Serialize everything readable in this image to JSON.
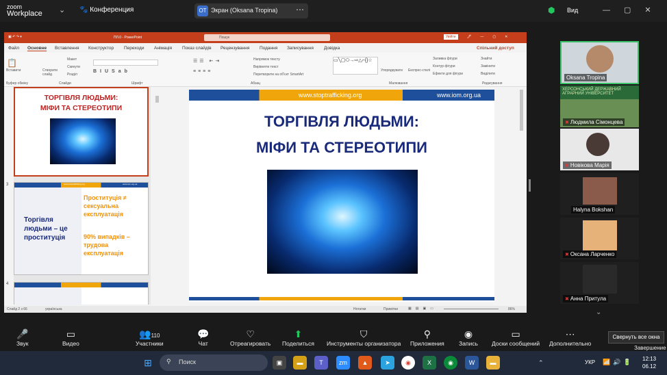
{
  "zoom": {
    "logo_top": "zoom",
    "logo_bottom": "Workplace",
    "conference": "Конференция",
    "screen_badge": "OT",
    "screen_label": "Экран (Oksana Tropina)",
    "view": "Вид"
  },
  "ppt": {
    "title": "ПЛ.0 - PowerPoint",
    "search": "Пошук",
    "account": "Увійти",
    "share": "Спільний доступ",
    "menu": [
      "Файл",
      "Основне",
      "Вставлення",
      "Конструктор",
      "Переходи",
      "Анімація",
      "Показ слайдів",
      "Рецензування",
      "Подання",
      "Записування",
      "Довідка"
    ],
    "ribbon": {
      "paste": "Вставити",
      "new_slide": "Створити слайд",
      "layout": "Макет",
      "reset": "Скинути",
      "section": "Розділ",
      "clipboard": "Буфер обміну",
      "slides": "Слайди",
      "font": "Шрифт",
      "paragraph": "Абзац",
      "drawing": "Малювання",
      "editing": "Редагування",
      "arrange": "Упорядкувати",
      "styles": "Експрес-стилі",
      "find": "Знайти",
      "replace": "Замінити",
      "select": "Виділити",
      "fill": "Заливка фігури",
      "outline": "Контур фігури",
      "effects": "Ефекти для фігури",
      "text_dir": "Напрямок тексту",
      "align_text": "Вирівняти текст",
      "smartart": "Перетворити на об'єкт SmartArt"
    },
    "thumb1": {
      "line1": "ТОРГІВЛЯ ЛЮДЬМИ:",
      "line2": "МІФИ ТА СТЕРЕОТИПИ"
    },
    "thumb2": {
      "num": "3",
      "left": "Торгівля людьми – це проституція",
      "right1": "Проституція ≠ сексуальна експлуатація",
      "right2": "90% випадків – трудова експлуатація",
      "url1": "www.stoptrafficking.org",
      "url2": "www.iom.org.ua"
    },
    "thumb3": {
      "num": "4"
    },
    "main": {
      "url1": "www.stoptrafficking.org",
      "url2": "www.iom.org.ua",
      "line1": "ТОРГІВЛЯ ЛЮДЬМИ:",
      "line2": "МІФИ ТА СТЕРЕОТИПИ"
    },
    "status": {
      "slide": "Слайд 2 з 66",
      "lang": "українська",
      "notes": "Нотатки",
      "comments": "Примітки",
      "zoom": "86%"
    }
  },
  "participants": [
    "Oksana Tropina",
    "Людмила Сімонцева",
    "Новікова Марія",
    "Halyna Bokshan",
    "Оксана Ларченко",
    "Анна Притула"
  ],
  "toolbar": {
    "sound": "Звук",
    "video": "Видео",
    "participants": "Участники",
    "participants_count": "110",
    "chat": "Чат",
    "react": "Отреагировать",
    "share": "Поделиться",
    "host_tools": "Инструменты организатора",
    "apps": "Приложения",
    "record": "Запись",
    "boards": "Доски сообщений",
    "more": "Дополнительно",
    "collapse": "Свернуть все окна",
    "end": "Завершение"
  },
  "taskbar": {
    "search": "Поиск",
    "lang": "УКР",
    "time": "12:13",
    "date": "06.12"
  }
}
